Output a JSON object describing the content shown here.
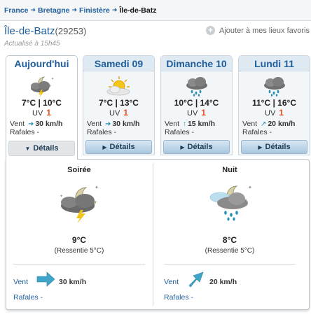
{
  "breadcrumb": {
    "items": [
      "France",
      "Bretagne",
      "Finistère"
    ],
    "current": "Île-de-Batz",
    "sep": "➜"
  },
  "header": {
    "city": "Île-de-Batz",
    "code": "(29253)",
    "fav_label": "Ajouter à mes lieux favoris",
    "updated": "Actualisé à 15h45"
  },
  "labels": {
    "uv": "UV",
    "vent": "Vent",
    "rafales": "Rafales -",
    "details": "Détails"
  },
  "days": [
    {
      "name": "Aujourd'hui",
      "temp": "7°C | 10°C",
      "uv": "1",
      "wind": "30 km/h",
      "wind_arrow": "➜",
      "icon": "night-storm-icon"
    },
    {
      "name": "Samedi 09",
      "temp": "7°C | 13°C",
      "uv": "1",
      "wind": "30 km/h",
      "wind_arrow": "➜",
      "icon": "sun-cloud-icon"
    },
    {
      "name": "Dimanche 10",
      "temp": "10°C | 14°C",
      "uv": "1",
      "wind": "15 km/h",
      "wind_arrow": "↑",
      "icon": "rain-cloud-icon"
    },
    {
      "name": "Lundi 11",
      "temp": "11°C | 16°C",
      "uv": "1",
      "wind": "20 km/h",
      "wind_arrow": "↗",
      "icon": "rain-cloud-icon"
    }
  ],
  "details": {
    "soiree": {
      "title": "Soirée",
      "temp": "9°C",
      "feel": "(Ressentie 5°C)",
      "wind": "30 km/h",
      "icon": "night-storm-icon"
    },
    "nuit": {
      "title": "Nuit",
      "temp": "8°C",
      "feel": "(Ressentie 5°C)",
      "wind": "20 km/h",
      "icon": "night-rain-icon"
    }
  },
  "colors": {
    "link": "#1f5e9c",
    "uv": "#e8501e",
    "wind_arrow": "#2a8fb0"
  }
}
